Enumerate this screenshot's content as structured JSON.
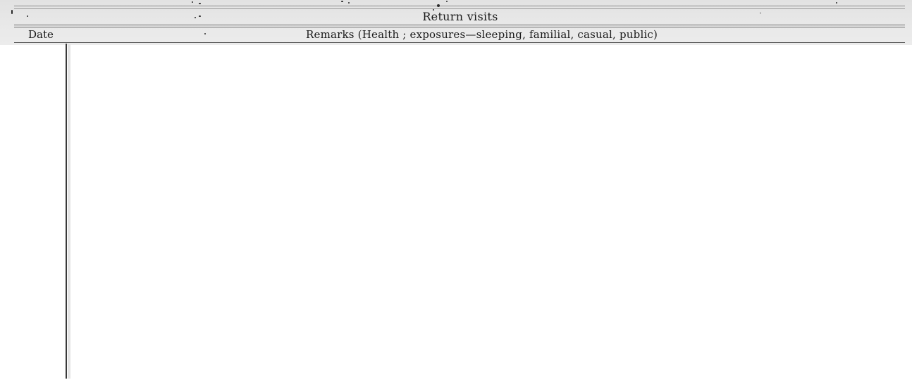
{
  "form": {
    "section_title": "Return visits",
    "columns": {
      "date_header": "Date",
      "remarks_header": "Remarks (Health ; exposures—sleeping, familial, casual, public)"
    }
  }
}
